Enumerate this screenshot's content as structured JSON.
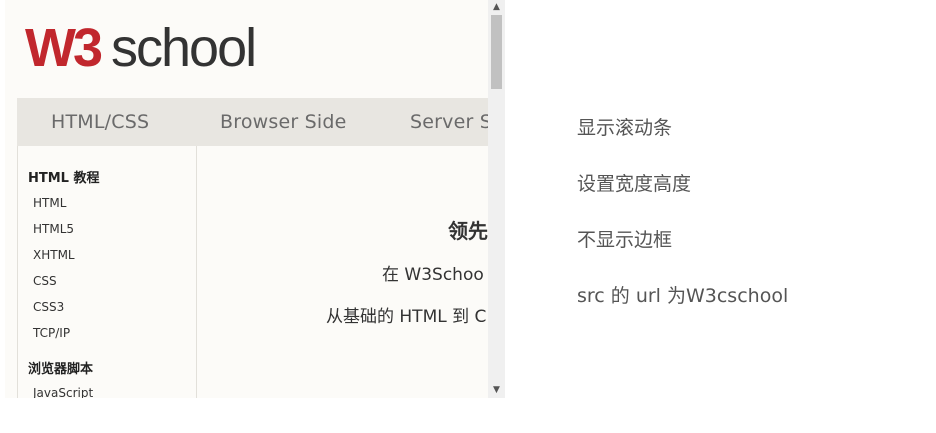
{
  "iframe": {
    "logo": {
      "text": "W3school",
      "mark_color": "#c1272d",
      "text_color": "#333333"
    },
    "nav": {
      "items": [
        "HTML/CSS",
        "Browser Side",
        "Server Si"
      ]
    },
    "sidebar": {
      "sections": [
        {
          "title": "HTML 教程",
          "links": [
            "HTML",
            "HTML5",
            "XHTML",
            "CSS",
            "CSS3",
            "TCP/IP"
          ]
        },
        {
          "title": "浏览器脚本",
          "links": [
            "JavaScript"
          ]
        }
      ]
    },
    "main": {
      "title": "领先",
      "line1": "在 W3Schoo",
      "line2": "从基础的 HTML 到 C"
    },
    "scrollbar": {
      "up_glyph": "▲",
      "down_glyph": "▼"
    }
  },
  "notes": [
    "显示滚动条",
    "设置宽度高度",
    "不显示边框",
    "src 的 url 为W3cschool"
  ]
}
